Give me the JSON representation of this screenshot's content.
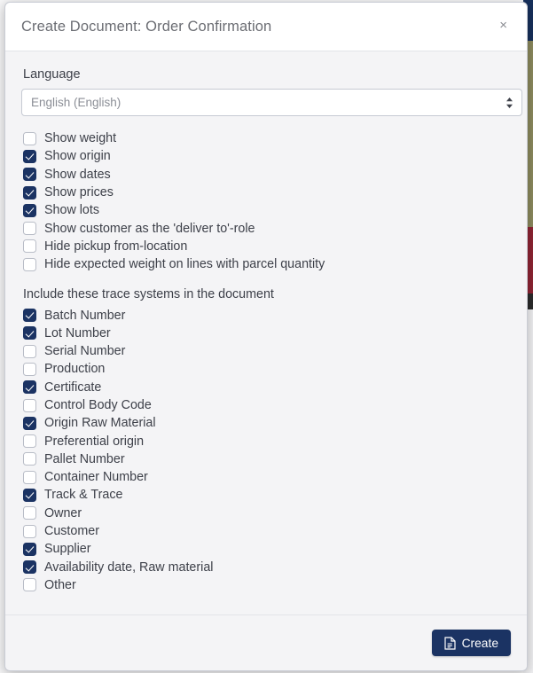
{
  "background": {
    "description": "underlying-application-page"
  },
  "modal": {
    "title": "Create Document: Order Confirmation",
    "close_label": "×",
    "close_icon": "close-icon",
    "language": {
      "label": "Language",
      "selected": "English (English)",
      "dropdown_icon": "chevron-up-down-icon"
    },
    "display_options": [
      {
        "label": "Show weight",
        "checked": false
      },
      {
        "label": "Show origin",
        "checked": true
      },
      {
        "label": "Show dates",
        "checked": true
      },
      {
        "label": "Show prices",
        "checked": true
      },
      {
        "label": "Show lots",
        "checked": true
      },
      {
        "label": "Show customer as the 'deliver to'-role",
        "checked": false
      },
      {
        "label": "Hide pickup from-location",
        "checked": false
      },
      {
        "label": "Hide expected weight on lines with parcel quantity",
        "checked": false
      }
    ],
    "trace_systems": {
      "heading": "Include these trace systems in the document",
      "items": [
        {
          "label": "Batch Number",
          "checked": true
        },
        {
          "label": "Lot Number",
          "checked": true
        },
        {
          "label": "Serial Number",
          "checked": false
        },
        {
          "label": "Production",
          "checked": false
        },
        {
          "label": "Certificate",
          "checked": true
        },
        {
          "label": "Control Body Code",
          "checked": false
        },
        {
          "label": "Origin Raw Material",
          "checked": true
        },
        {
          "label": "Preferential origin",
          "checked": false
        },
        {
          "label": "Pallet Number",
          "checked": false
        },
        {
          "label": "Container Number",
          "checked": false
        },
        {
          "label": "Track & Trace",
          "checked": true
        },
        {
          "label": "Owner",
          "checked": false
        },
        {
          "label": "Customer",
          "checked": false
        },
        {
          "label": "Supplier",
          "checked": true
        },
        {
          "label": "Availability date, Raw material",
          "checked": true
        },
        {
          "label": "Other",
          "checked": false
        }
      ]
    },
    "footer": {
      "create_label": "Create",
      "create_icon": "document-icon"
    }
  },
  "colors": {
    "accent": "#1b3363",
    "modal_bg": "#f4f4f6",
    "header_bg": "#ffffff",
    "text": "#3d4049",
    "title_text": "#6b6d73"
  }
}
